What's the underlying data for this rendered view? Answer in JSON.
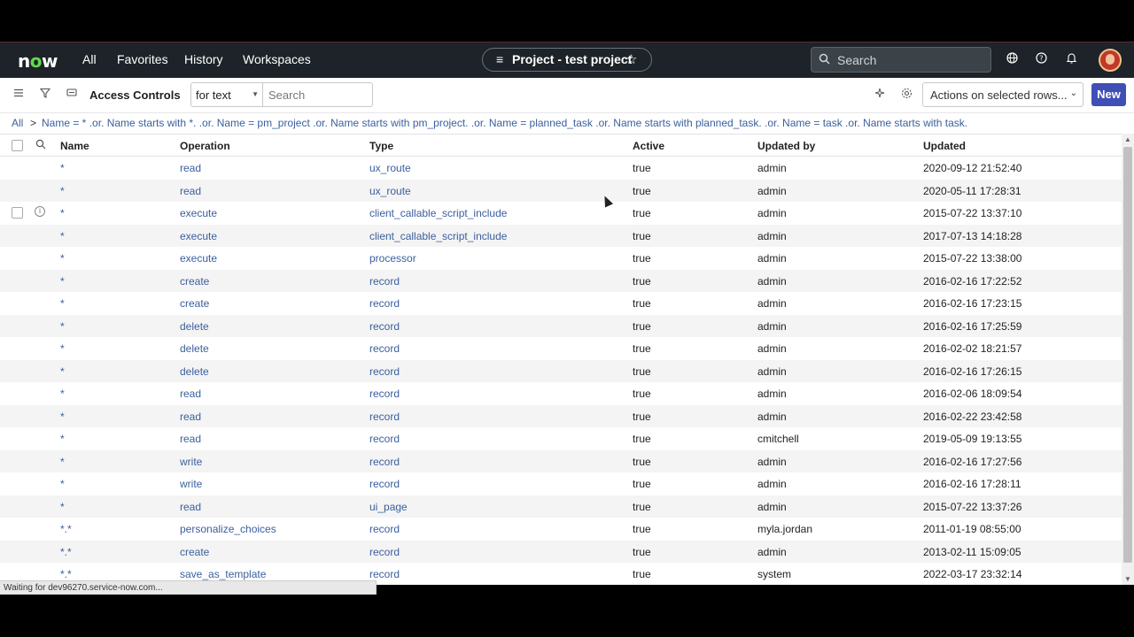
{
  "nav": {
    "logo": "now",
    "links": [
      "All",
      "Favorites",
      "History",
      "Workspaces"
    ],
    "workspace_title": "Project - test project",
    "search_placeholder": "Search"
  },
  "toolbar": {
    "title": "Access Controls",
    "for_text": "for text",
    "search_placeholder": "Search",
    "actions_label": "Actions on selected rows...",
    "new_label": "New"
  },
  "breadcrumb": {
    "all": "All",
    "separator": ">",
    "condition": "Name = * .or. Name starts with *. .or. Name = pm_project .or. Name starts with pm_project. .or. Name = planned_task .or. Name starts with planned_task. .or. Name = task .or. Name starts with task."
  },
  "table": {
    "headers": [
      "Name",
      "Operation",
      "Type",
      "Active",
      "Updated by",
      "Updated"
    ],
    "rows": [
      {
        "name": "*",
        "op": "read",
        "type": "ux_route",
        "active": "true",
        "by": "admin",
        "updated": "2020-09-12 21:52:40"
      },
      {
        "name": "*",
        "op": "read",
        "type": "ux_route",
        "active": "true",
        "by": "admin",
        "updated": "2020-05-11 17:28:31"
      },
      {
        "name": "*",
        "op": "execute",
        "type": "client_callable_script_include",
        "active": "true",
        "by": "admin",
        "updated": "2015-07-22 13:37:10"
      },
      {
        "name": "*",
        "op": "execute",
        "type": "client_callable_script_include",
        "active": "true",
        "by": "admin",
        "updated": "2017-07-13 14:18:28"
      },
      {
        "name": "*",
        "op": "execute",
        "type": "processor",
        "active": "true",
        "by": "admin",
        "updated": "2015-07-22 13:38:00"
      },
      {
        "name": "*",
        "op": "create",
        "type": "record",
        "active": "true",
        "by": "admin",
        "updated": "2016-02-16 17:22:52"
      },
      {
        "name": "*",
        "op": "create",
        "type": "record",
        "active": "true",
        "by": "admin",
        "updated": "2016-02-16 17:23:15"
      },
      {
        "name": "*",
        "op": "delete",
        "type": "record",
        "active": "true",
        "by": "admin",
        "updated": "2016-02-16 17:25:59"
      },
      {
        "name": "*",
        "op": "delete",
        "type": "record",
        "active": "true",
        "by": "admin",
        "updated": "2016-02-02 18:21:57"
      },
      {
        "name": "*",
        "op": "delete",
        "type": "record",
        "active": "true",
        "by": "admin",
        "updated": "2016-02-16 17:26:15"
      },
      {
        "name": "*",
        "op": "read",
        "type": "record",
        "active": "true",
        "by": "admin",
        "updated": "2016-02-06 18:09:54"
      },
      {
        "name": "*",
        "op": "read",
        "type": "record",
        "active": "true",
        "by": "admin",
        "updated": "2016-02-22 23:42:58"
      },
      {
        "name": "*",
        "op": "read",
        "type": "record",
        "active": "true",
        "by": "cmitchell",
        "updated": "2019-05-09 19:13:55"
      },
      {
        "name": "*",
        "op": "write",
        "type": "record",
        "active": "true",
        "by": "admin",
        "updated": "2016-02-16 17:27:56"
      },
      {
        "name": "*",
        "op": "write",
        "type": "record",
        "active": "true",
        "by": "admin",
        "updated": "2016-02-16 17:28:11"
      },
      {
        "name": "*",
        "op": "read",
        "type": "ui_page",
        "active": "true",
        "by": "admin",
        "updated": "2015-07-22 13:37:26"
      },
      {
        "name": "*.*",
        "op": "personalize_choices",
        "type": "record",
        "active": "true",
        "by": "myla.jordan",
        "updated": "2011-01-19 08:55:00"
      },
      {
        "name": "*.*",
        "op": "create",
        "type": "record",
        "active": "true",
        "by": "admin",
        "updated": "2013-02-11 15:09:05"
      },
      {
        "name": "*.*",
        "op": "save_as_template",
        "type": "record",
        "active": "true",
        "by": "system",
        "updated": "2022-03-17 23:32:14"
      }
    ]
  },
  "status_text": "Waiting for dev96270.service-now.com..."
}
